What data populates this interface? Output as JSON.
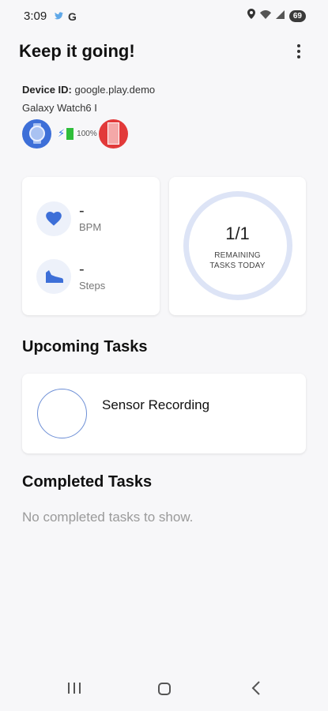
{
  "status_bar": {
    "time": "3:09",
    "left_icons": [
      "twitter-icon",
      "google-icon"
    ],
    "google_letter": "G",
    "right_icons": [
      "location-icon",
      "wifi-icon",
      "signal-icon"
    ],
    "battery": "69"
  },
  "header": {
    "title": "Keep it going!",
    "menu_icon": "more-vertical-icon"
  },
  "device": {
    "id_label": "Device ID:",
    "id_value": "google.play.demo",
    "name": "Galaxy Watch6 I",
    "battery_text": "100%",
    "colors": {
      "watch": "#3d6fd8",
      "charge": "#2fbd3a",
      "alert": "#e23a3a"
    }
  },
  "stats": {
    "heart_rate": {
      "value": "-",
      "unit": "BPM",
      "icon": "heart-icon"
    },
    "steps": {
      "value": "-",
      "unit": "Steps",
      "icon": "shoe-icon"
    }
  },
  "progress": {
    "value": "1/1",
    "label_line1": "REMAINING",
    "label_line2": "TASKS TODAY"
  },
  "upcoming": {
    "title": "Upcoming Tasks",
    "tasks": [
      {
        "name": "Sensor Recording"
      }
    ]
  },
  "completed": {
    "title": "Completed Tasks",
    "empty_text": "No completed tasks to show."
  },
  "nav": {
    "icons": [
      "recents-icon",
      "home-icon",
      "back-icon"
    ]
  },
  "colors": {
    "accent": "#3d6fd8",
    "ring": "#dde4f6",
    "background": "#f7f7f9"
  }
}
